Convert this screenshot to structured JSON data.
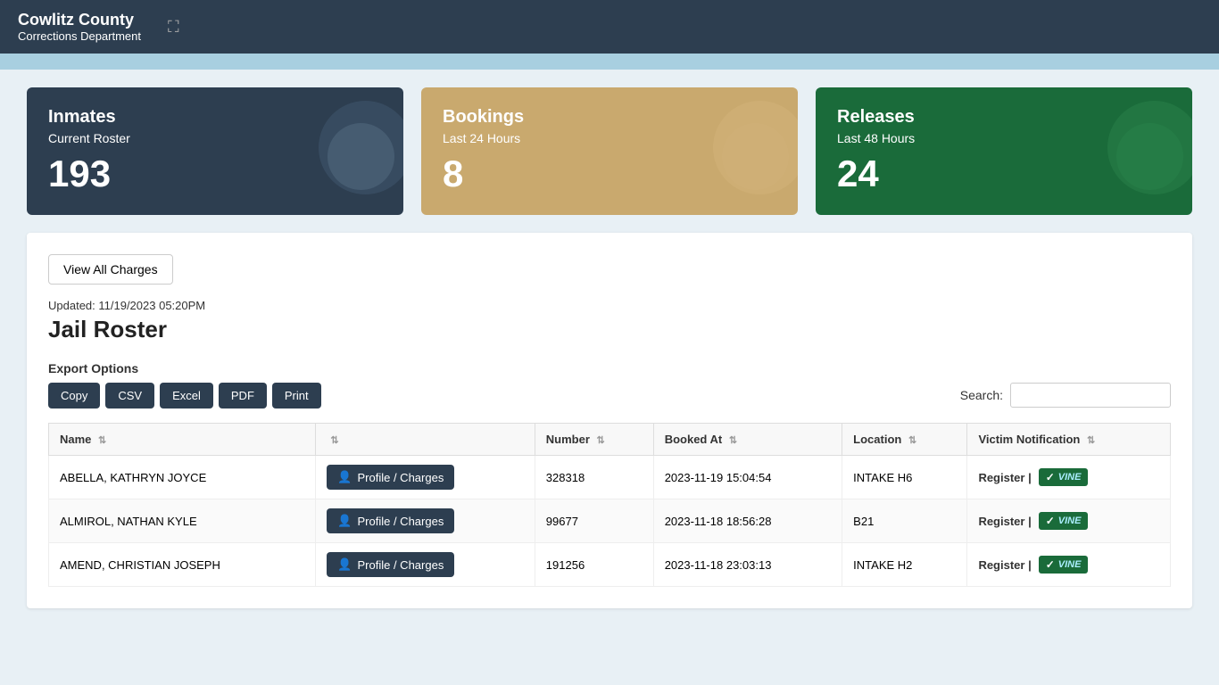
{
  "header": {
    "title": "Cowlitz County",
    "subtitle": "Corrections Department",
    "icon": "⛶"
  },
  "stats": {
    "inmates": {
      "title": "Inmates",
      "subtitle": "Current Roster",
      "number": "193"
    },
    "bookings": {
      "title": "Bookings",
      "subtitle": "Last 24 Hours",
      "number": "8"
    },
    "releases": {
      "title": "Releases",
      "subtitle": "Last 48 Hours",
      "number": "24"
    }
  },
  "content": {
    "view_all_charges_label": "View All Charges",
    "updated_text": "Updated: 11/19/2023 05:20PM",
    "jail_roster_title": "Jail Roster",
    "export_label": "Export Options",
    "export_buttons": [
      "Copy",
      "CSV",
      "Excel",
      "PDF",
      "Print"
    ],
    "search_label": "Search:",
    "search_placeholder": "",
    "table": {
      "columns": [
        "Name",
        "",
        "Number",
        "Booked At",
        "Location",
        "Victim Notification"
      ],
      "rows": [
        {
          "name": "ABELLA, KATHRYN JOYCE",
          "profile_label": "Profile / Charges",
          "number": "328318",
          "booked_at": "2023-11-19 15:04:54",
          "location": "INTAKE H6",
          "register_label": "Register |"
        },
        {
          "name": "ALMIROL, NATHAN KYLE",
          "profile_label": "Profile / Charges",
          "number": "99677",
          "booked_at": "2023-11-18 18:56:28",
          "location": "B21",
          "register_label": "Register |"
        },
        {
          "name": "AMEND, CHRISTIAN JOSEPH",
          "profile_label": "Profile / Charges",
          "number": "191256",
          "booked_at": "2023-11-18 23:03:13",
          "location": "INTAKE H2",
          "register_label": "Register |"
        }
      ]
    }
  }
}
